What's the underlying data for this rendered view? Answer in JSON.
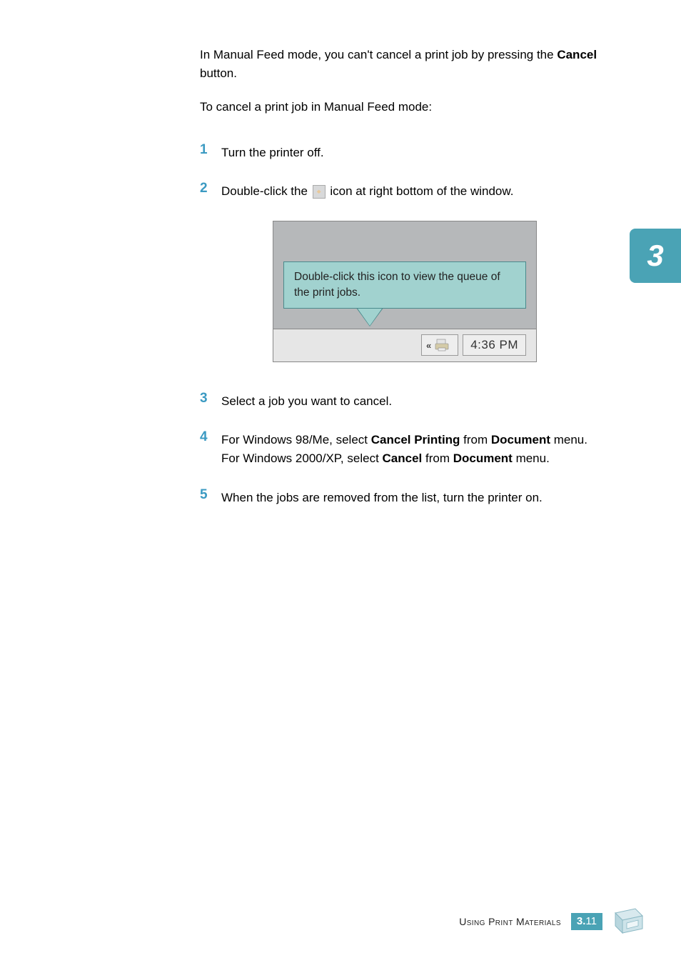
{
  "intro": {
    "line1_a": "In Manual Feed mode, you can't cancel a print job by pressing the ",
    "line1_b": "Cancel",
    "line1_c": " button.",
    "line2": "To cancel a print job in Manual Feed mode:"
  },
  "steps": {
    "n1": "1",
    "s1": "Turn the printer off.",
    "n2": "2",
    "s2a": "Double-click the ",
    "s2b": " icon at right bottom of the window.",
    "n3": "3",
    "s3": "Select a job you want to cancel.",
    "n4": "4",
    "s4a": "For Windows 98/Me, select ",
    "s4b": "Cancel Printing",
    "s4c": " from ",
    "s4d": "Document",
    "s4e": " menu.",
    "s4f": "For Windows 2000/XP, select ",
    "s4g": "Cancel",
    "s4h": " from ",
    "s4i": "Document",
    "s4j": " menu.",
    "n5": "5",
    "s5": "When the jobs are removed from the list, turn the printer on."
  },
  "figure": {
    "tooltip": "Double-click this icon to view the queue of the print jobs.",
    "time": "4:36 PM"
  },
  "tab": {
    "num": "3"
  },
  "footer": {
    "title": "Using Print Materials",
    "chapter": "3.",
    "page": "11"
  }
}
